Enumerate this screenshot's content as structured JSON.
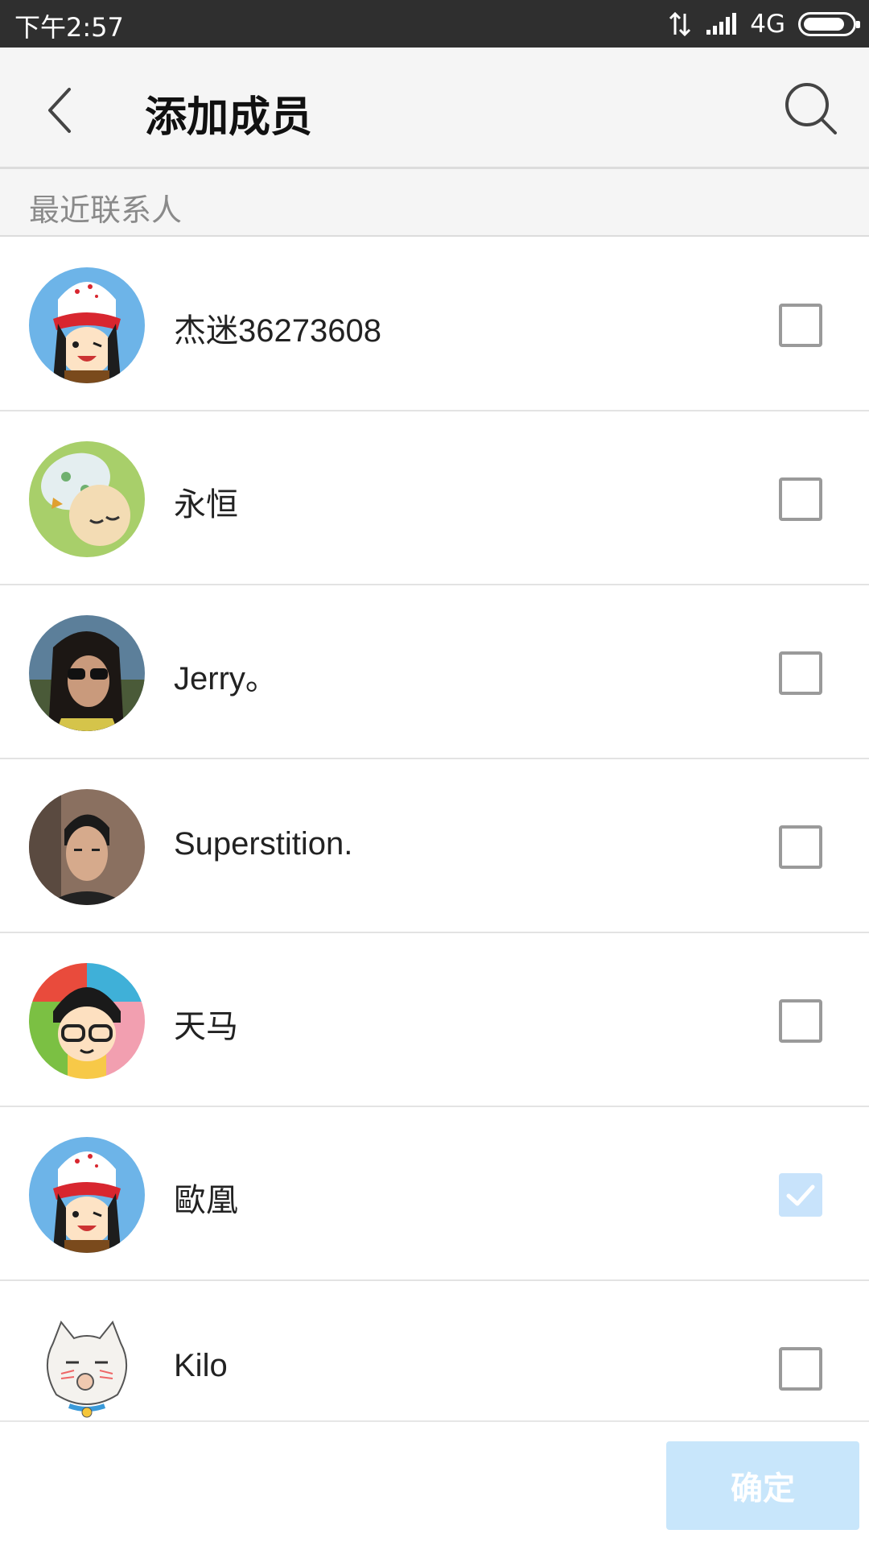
{
  "status_bar": {
    "time": "下午2:57",
    "network": "4G",
    "icons": [
      "data-transfer-icon",
      "signal-icon",
      "battery-icon"
    ]
  },
  "header": {
    "title": "添加成员",
    "back_icon": "chevron-left-icon",
    "search_icon": "search-icon"
  },
  "section": {
    "title": "最近联系人"
  },
  "contacts": [
    {
      "name": "杰迷36273608",
      "checked": false,
      "avatar": "cartoon-cap-guitar"
    },
    {
      "name": "永恒",
      "checked": false,
      "avatar": "cartoon-baby-sleeping"
    },
    {
      "name": "Jerry。",
      "checked": false,
      "avatar": "photo-sunglasses"
    },
    {
      "name": "Superstition.",
      "checked": false,
      "avatar": "photo-young-man"
    },
    {
      "name": "天马",
      "checked": false,
      "avatar": "cartoon-glasses-boy"
    },
    {
      "name": "歐凰",
      "checked": true,
      "avatar": "cartoon-cap-guitar"
    },
    {
      "name": "Kilo",
      "checked": false,
      "avatar": "cartoon-white-cat"
    }
  ],
  "footer": {
    "confirm_label": "确定"
  },
  "colors": {
    "status_bar": "#2f2f2f",
    "header_bg": "#f5f5f5",
    "checked_box": "#c8e3fb",
    "confirm_disabled": "#c8e6fb"
  }
}
